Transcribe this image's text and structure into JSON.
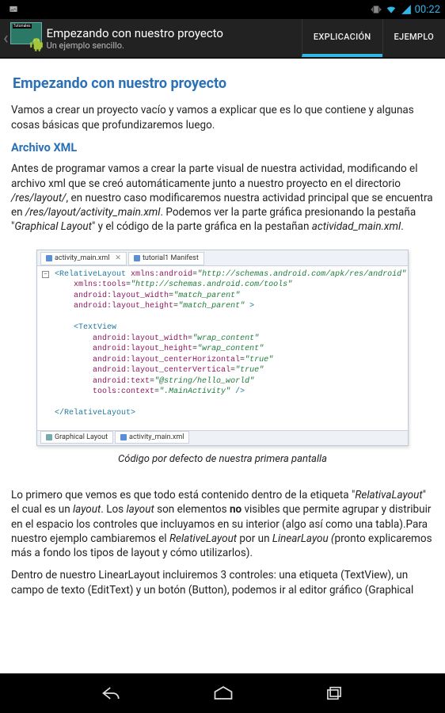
{
  "status": {
    "time": "00:22"
  },
  "actionbar": {
    "title": "Empezando con nuestro proyecto",
    "subtitle": "Un ejemplo sencillo.",
    "app_icon_label": "Tutoriales"
  },
  "tabs": {
    "items": [
      {
        "label": "EXPLICACIÓN",
        "active": true
      },
      {
        "label": "EJEMPLO",
        "active": false
      }
    ]
  },
  "article": {
    "h1": "Empezando con nuestro proyecto",
    "p1": "Vamos a crear un proyecto vacío y vamos a explicar que es lo que contiene y algunas cosas básicas que profundizaremos luego.",
    "h2": "Archivo XML",
    "p2_a": "Antes de programar vamos a crear la parte visual de nuestra actividad, modificando el archivo xml que se creó automáticamente junto a nuestro proyecto en el directorio ",
    "p2_path1": "/res/layout/",
    "p2_b": ", en nuestro caso modificaremos nuestra actividad principal que se encuentra en ",
    "p2_path2": "/res/layout/activity_main.xml",
    "p2_c": ". Podemos ver la parte gráfica presionando la pestaña \"",
    "p2_tab1": "Graphical Layout",
    "p2_d": "\" y el código de la parte gráfica en la pestañan ",
    "p2_tab2": "actividad_main.xml",
    "p2_e": ".",
    "caption": "Código por defecto de nuestra primera pantalla",
    "p3_a": "Lo primero que vemos es que todo está contenido dentro de la etiqueta \"",
    "p3_em1": "RelativaLayout",
    "p3_b": "\" el cual es un ",
    "p3_em2": "layout",
    "p3_c": ". Los ",
    "p3_em3": "layout",
    "p3_d": " son elementos ",
    "p3_strong": "no",
    "p3_e": " visibles que permite agrupar y distribuir en el espacio los controles que incluyamos en su interior (algo así como una tabla).Para nuestro ejemplo cambiaremos el ",
    "p3_em4": "RelativeLayout",
    "p3_f": " por un ",
    "p3_em5": "LinearLayou (",
    "p3_g": "pronto explicaremos más a fondo los tipos de layout y cómo utilizarlos).",
    "p4": "Dentro de nuestro LinearLayout incluiremos 3 controles: una etiqueta (TextView), un campo de texto (EditText) y un botón (Button), podemos ir al editor gráfico (Graphical"
  },
  "code": {
    "top_tabs": [
      "activity_main.xml",
      "tutorial1 Manifest"
    ],
    "bottom_tabs": [
      "Graphical Layout",
      "activity_main.xml"
    ],
    "lines": [
      {
        "t": "open",
        "tag": "RelativeLayout",
        "attrs": [
          {
            "n": "xmlns:android",
            "v": "http://schemas.android.com/apk/res/android"
          }
        ]
      },
      {
        "t": "attr",
        "attrs": [
          {
            "n": "xmlns:tools",
            "v": "http://schemas.android.com/tools"
          }
        ]
      },
      {
        "t": "attr",
        "attrs": [
          {
            "n": "android:layout_width",
            "v": "match_parent"
          }
        ]
      },
      {
        "t": "attr",
        "attrs": [
          {
            "n": "android:layout_height",
            "v": "match_parent"
          }
        ],
        "close": " >"
      },
      {
        "t": "blank"
      },
      {
        "t": "open",
        "indent": 1,
        "tag": "TextView",
        "attrs": []
      },
      {
        "t": "attr",
        "indent": 1,
        "attrs": [
          {
            "n": "android:layout_width",
            "v": "wrap_content"
          }
        ]
      },
      {
        "t": "attr",
        "indent": 1,
        "attrs": [
          {
            "n": "android:layout_height",
            "v": "wrap_content"
          }
        ]
      },
      {
        "t": "attr",
        "indent": 1,
        "attrs": [
          {
            "n": "android:layout_centerHorizontal",
            "v": "true"
          }
        ]
      },
      {
        "t": "attr",
        "indent": 1,
        "attrs": [
          {
            "n": "android:layout_centerVertical",
            "v": "true"
          }
        ]
      },
      {
        "t": "attr",
        "indent": 1,
        "attrs": [
          {
            "n": "android:text",
            "v": "@string/hello_world"
          }
        ]
      },
      {
        "t": "attr",
        "indent": 1,
        "attrs": [
          {
            "n": "tools:context",
            "v": ".MainActivity"
          }
        ],
        "close": " />"
      },
      {
        "t": "blank"
      },
      {
        "t": "closeTag",
        "tag": "RelativeLayout"
      }
    ]
  }
}
